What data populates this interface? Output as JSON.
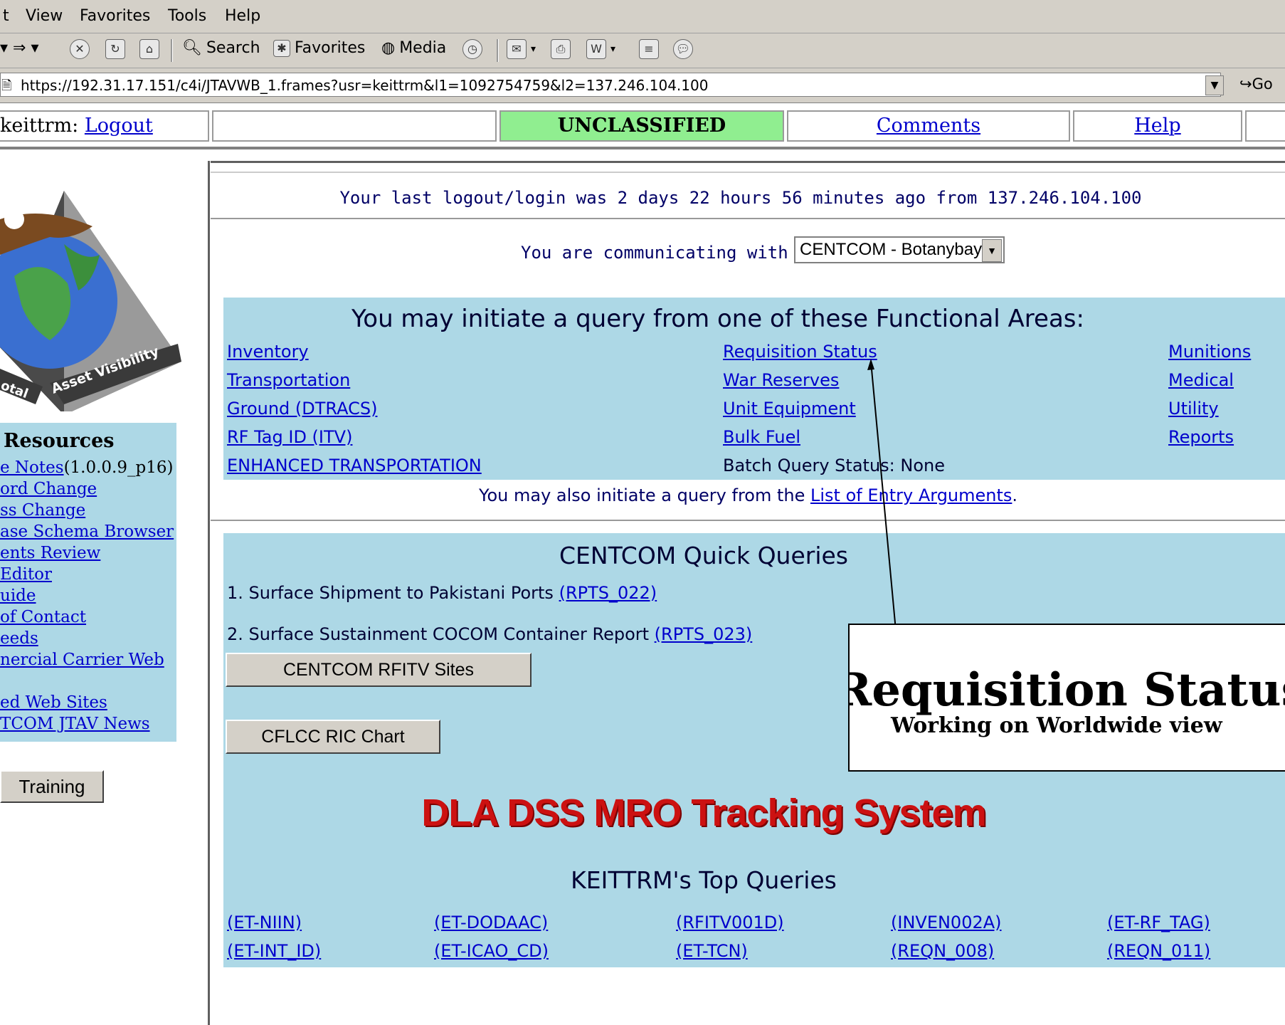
{
  "menu": {
    "items": [
      "t",
      "View",
      "Favorites",
      "Tools",
      "Help"
    ]
  },
  "toolbar": {
    "back_icon": "back-arrow-icon",
    "forward_icon": "forward-arrow-icon",
    "search_label": "Search",
    "favorites_label": "Favorites",
    "media_label": "Media"
  },
  "address": {
    "url": "https://192.31.17.151/c4i/JTAVWB_1.frames?usr=keittrm&l1=1092754759&l2=137.246.104.100",
    "go_label": "Go"
  },
  "topbar": {
    "user": "keittrm:",
    "logout": "Logout",
    "classification": "UNCLASSIFIED",
    "comments": "Comments",
    "help": "Help",
    "classification_color": "#90ee90"
  },
  "sidebar": {
    "logo_text": "Asset Visibility",
    "logo_text_partial": "otal",
    "resources_title": "Resources",
    "items": [
      "e Notes",
      "ord Change",
      "ss Change",
      "ase Schema Browser",
      "ents Review",
      " Editor",
      "uide",
      " of Contact",
      "eeds",
      "nercial Carrier Web",
      "ed Web Sites",
      "TCOM JTAV News"
    ],
    "release_version": "(1.0.0.9_p16)",
    "training_label": "Training"
  },
  "main": {
    "last_login": "Your last logout/login was 2 days 22 hours 56 minutes ago from 137.246.104.100",
    "communicating_label": "You are communicating with",
    "communicating_value": "CENTCOM - Botanybay",
    "functional_title": "You may initiate a query from one of these Functional Areas:",
    "col1": [
      "Inventory",
      "Transportation",
      "Ground (DTRACS)",
      "RF Tag ID (ITV)",
      "ENHANCED TRANSPORTATION"
    ],
    "col2": [
      "Requisition Status",
      "War Reserves",
      "Unit Equipment",
      "Bulk Fuel"
    ],
    "batch_status": "Batch Query Status: None",
    "col3": [
      "Munitions",
      "Medical",
      "Utility",
      "Reports"
    ],
    "also_prefix": "You may also initiate a query from the",
    "also_link": "List of Entry Arguments",
    "also_suffix": ".",
    "quick_title": "CENTCOM Quick Queries",
    "q1_text": "1. Surface Shipment to Pakistani Ports",
    "q1_link": "(RPTS_022)",
    "q2_text": "2. Surface Sustainment COCOM Container Report",
    "q2_link": "(RPTS_023)",
    "rfitv_button": "CENTCOM RFITV Sites",
    "ric_button": "CFLCC RIC Chart",
    "dla_title": "DLA DSS MRO Tracking System",
    "dla_color": "#cc1111",
    "top_queries_title": "KEITTRM's Top Queries",
    "top_row1": [
      "(ET-NIIN)",
      "(ET-DODAAC)",
      "(RFITV001D)",
      "(INVEN002A)",
      "(ET-RF_TAG)"
    ],
    "top_row2": [
      "(ET-INT_ID)",
      "(ET-ICAO_CD)",
      "(ET-TCN)",
      "(REQN_008)",
      "(REQN_011)"
    ]
  },
  "callout": {
    "title": "Requisition Status",
    "subtitle": "Working on Worldwide view"
  }
}
